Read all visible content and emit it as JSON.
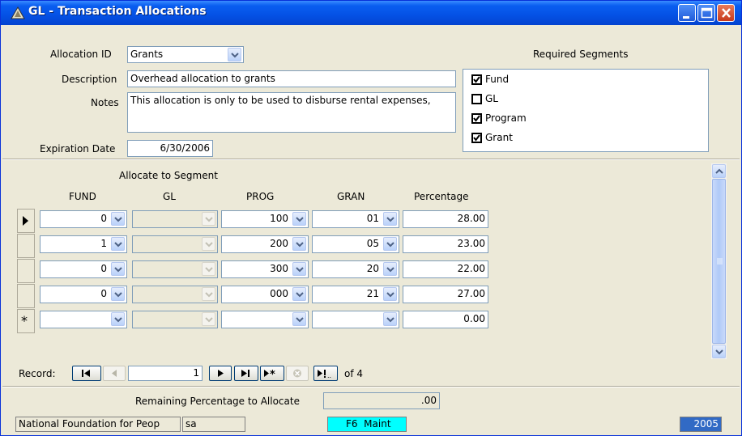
{
  "window": {
    "title": "GL - Transaction Allocations"
  },
  "header": {
    "allocation_id_label": "Allocation ID",
    "allocation_id_value": "Grants",
    "description_label": "Description",
    "description_value": "Overhead allocation to grants",
    "notes_label": "Notes",
    "notes_value": "This allocation is only to be used to disburse rental expenses,",
    "expiration_label": "Expiration Date",
    "expiration_value": "6/30/2006"
  },
  "required_segments": {
    "title": "Required Segments",
    "items": [
      {
        "label": "Fund",
        "checked": true
      },
      {
        "label": "GL",
        "checked": false
      },
      {
        "label": "Program",
        "checked": true
      },
      {
        "label": "Grant",
        "checked": true
      }
    ]
  },
  "grid": {
    "group_label": "Allocate to Segment",
    "columns": [
      "FUND",
      "GL",
      "PROG",
      "GRAN",
      "Percentage"
    ],
    "rows": [
      {
        "fund": "0",
        "gl": "",
        "prog": "100",
        "gran": "01",
        "pct": "28.00",
        "marker": "current"
      },
      {
        "fund": "1",
        "gl": "",
        "prog": "200",
        "gran": "05",
        "pct": "23.00",
        "marker": ""
      },
      {
        "fund": "0",
        "gl": "",
        "prog": "300",
        "gran": "20",
        "pct": "22.00",
        "marker": ""
      },
      {
        "fund": "0",
        "gl": "",
        "prog": "000",
        "gran": "21",
        "pct": "27.00",
        "marker": ""
      },
      {
        "fund": "",
        "gl": "",
        "prog": "",
        "gran": "",
        "pct": "0.00",
        "marker": "new"
      }
    ]
  },
  "navigation": {
    "record_label": "Record:",
    "current": "1",
    "of_label": "of 4"
  },
  "footer": {
    "remaining_label": "Remaining Percentage to Allocate",
    "remaining_value": ".00",
    "org": "National Foundation for Peop",
    "user": "sa",
    "mode": "F6  Maint",
    "year": "2005"
  },
  "colors": {
    "title_blue": "#0451e5",
    "mode_cyan": "#00ffff",
    "year_blue": "#316ac5"
  }
}
